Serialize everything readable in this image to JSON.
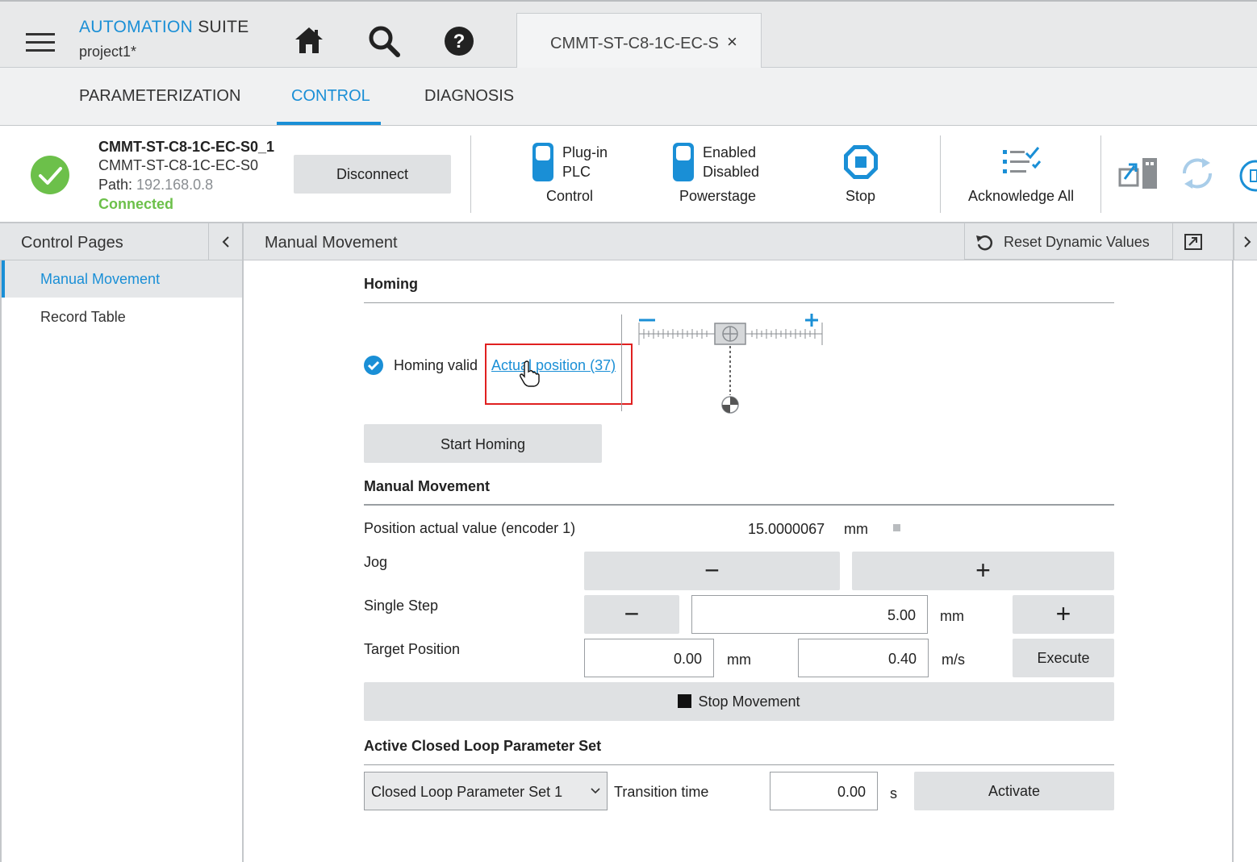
{
  "app": {
    "brand_part1": "AUTOMATION",
    "brand_part2": "SUITE",
    "project": "project1*",
    "doc_tab": "CMMT-ST-C8-1C-EC-S",
    "doc_tab_close": "×"
  },
  "nav": {
    "tabs": [
      {
        "label": "PARAMETERIZATION",
        "active": false
      },
      {
        "label": "CONTROL",
        "active": true
      },
      {
        "label": "DIAGNOSIS",
        "active": false
      }
    ]
  },
  "device": {
    "name": "CMMT-ST-C8-1C-EC-S0_1",
    "type": "CMMT-ST-C8-1C-EC-S0",
    "path_label": "Path:",
    "path_value": "192.168.0.8",
    "status": "Connected",
    "disconnect_label": "Disconnect",
    "control_toggle_line1": "Plug-in",
    "control_toggle_line2": "PLC",
    "control_label": "Control",
    "power_toggle_line1": "Enabled",
    "power_toggle_line2": "Disabled",
    "power_label": "Powerstage",
    "stop_label": "Stop",
    "ack_label": "Acknowledge All"
  },
  "subheader": {
    "sidebar_title": "Control Pages",
    "page_title": "Manual Movement",
    "reset_label": "Reset Dynamic Values"
  },
  "sidebar": {
    "items": [
      {
        "label": "Manual Movement",
        "selected": true
      },
      {
        "label": "Record Table",
        "selected": false
      }
    ]
  },
  "homing": {
    "title": "Homing",
    "valid_label": "Homing valid",
    "actual_link": "Actual position (37)",
    "start_label": "Start Homing",
    "scale_minus": "−",
    "scale_plus": "+"
  },
  "manual": {
    "title": "Manual Movement",
    "pos_label": "Position actual value (encoder 1)",
    "pos_value": "15.0000067",
    "pos_unit": "mm",
    "jog_label": "Jog",
    "jog_minus": "−",
    "jog_plus": "+",
    "step_label": "Single Step",
    "step_minus": "−",
    "step_value": "5.00",
    "step_unit": "mm",
    "step_plus": "+",
    "target_label": "Target Position",
    "target_value": "0.00",
    "target_unit": "mm",
    "speed_value": "0.40",
    "speed_unit": "m/s",
    "execute_label": "Execute",
    "stop_label": "Stop Movement"
  },
  "closed_loop": {
    "title": "Active Closed Loop Parameter Set",
    "selected": "Closed Loop Parameter Set 1",
    "transition_label": "Transition time",
    "transition_value": "0.00",
    "transition_unit": "s",
    "activate_label": "Activate"
  },
  "colors": {
    "accent": "#1a8fd6",
    "connected": "#6cc04a",
    "highlight_box": "#e02020"
  }
}
